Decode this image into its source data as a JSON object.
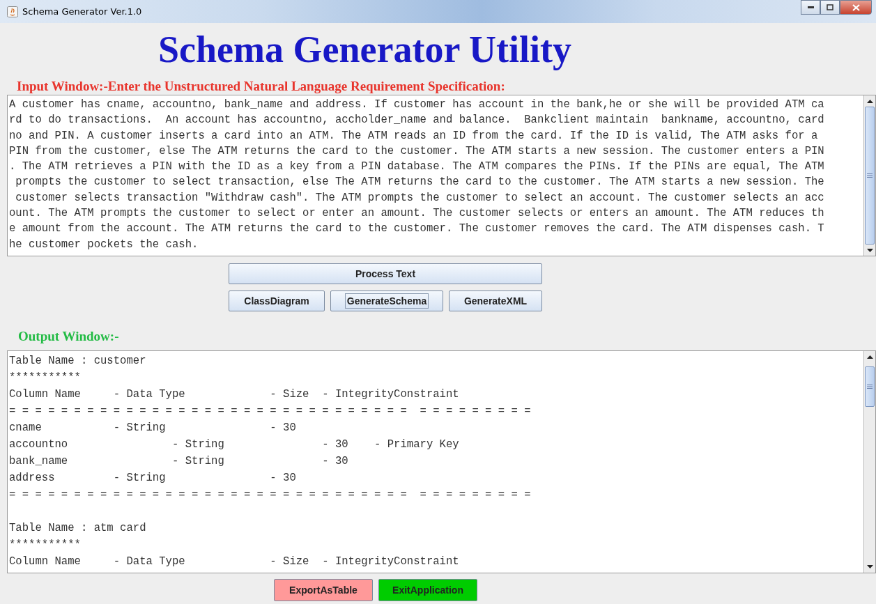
{
  "window": {
    "title": "Schema Generator Ver.1.0"
  },
  "heading": "Schema Generator Utility",
  "input_section": {
    "label": "Input Window:-Enter the Unstructured Natural Language Requirement Specification:",
    "lines": [
      "A customer has cname, accountno, bank_name and address. If customer has account in the bank,he or she will be provided ATM ca",
      "rd to do transactions.  An account has accountno, accholder_name and balance.  Bankclient maintain  bankname, accountno, card",
      "no and PIN. A customer inserts a card into an ATM. The ATM reads an ID from the card. If the ID is valid, The ATM asks for a ",
      "PIN from the customer, else The ATM returns the card to the customer. The ATM starts a new session. The customer enters a PIN",
      ". The ATM retrieves a PIN with the ID as a key from a PIN database. The ATM compares the PINs. If the PINs are equal, The ATM",
      " prompts the customer to select transaction, else The ATM returns the card to the customer. The ATM starts a new session. The",
      " customer selects transaction \"Withdraw cash\". The ATM prompts the customer to select an account. The customer selects an acc",
      "ount. The ATM prompts the customer to select or enter an amount. The customer selects or enters an amount. The ATM reduces th",
      "e amount from the account. The ATM returns the card to the customer. The customer removes the card. The ATM dispenses cash. T",
      "he customer pockets the cash."
    ]
  },
  "actions": {
    "primary": "Process Text",
    "buttons": [
      {
        "label": "ClassDiagram",
        "focused": false
      },
      {
        "label": "GenerateSchema",
        "focused": true
      },
      {
        "label": "GenerateXML",
        "focused": false
      }
    ]
  },
  "output_section": {
    "label": "Output Window:-",
    "blocks": [
      [
        "Table Name : customer",
        "***********",
        "Column Name     - Data Type             - Size  - IntegrityConstraint",
        "= = = = = = = = = = = = = = = = = = = = = = = = = = = = = = =  = = = = = = = = =",
        "cname           - String                - 30",
        "accountno                - String               - 30    - Primary Key",
        "bank_name                - String               - 30",
        "address         - String                - 30",
        "= = = = = = = = = = = = = = = = = = = = = = = = = = = = = = =  = = = = = = = = ="
      ],
      [
        "Table Name : atm card",
        "***********",
        "Column Name     - Data Type             - Size  - IntegrityConstraint"
      ]
    ]
  },
  "footer_buttons": [
    {
      "label": "ExportAsTable",
      "color": "#ff9999"
    },
    {
      "label": "ExitApplication",
      "color": "#00cc00"
    }
  ]
}
